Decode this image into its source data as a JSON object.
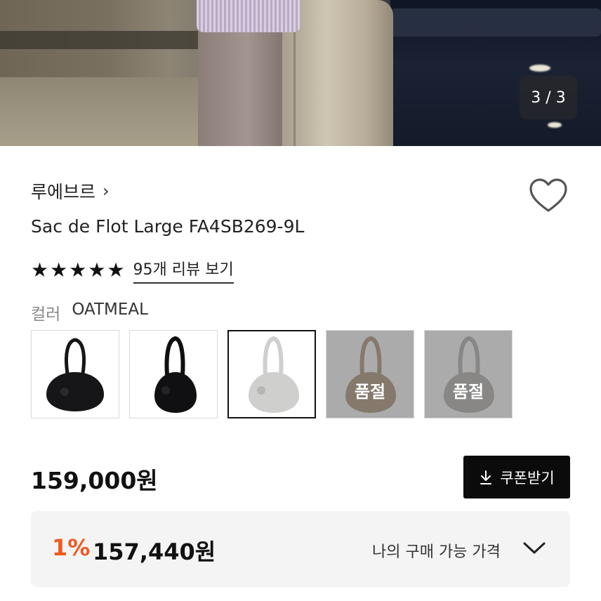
{
  "gallery": {
    "counter": "3 / 3"
  },
  "product": {
    "brand": "루에브르",
    "brand_chevron": "›",
    "title": "Sac de Flot Large FA4SB269-9L",
    "rating_stars": 5,
    "review_link": "95개 리뷰 보기"
  },
  "color": {
    "label": "컬러",
    "selected": "OATMEAL",
    "options": [
      {
        "bag_color": "#161618",
        "sold_out": false,
        "selected": false
      },
      {
        "bag_color": "#101012",
        "sold_out": false,
        "selected": false
      },
      {
        "bag_color": "#cfcfcd",
        "sold_out": false,
        "selected": true
      },
      {
        "bag_color": "#9b7b5b",
        "sold_out": true,
        "sold_label": "품절",
        "selected": false
      },
      {
        "bag_color": "#a4a09d",
        "sold_out": true,
        "sold_label": "품절",
        "selected": false
      }
    ]
  },
  "price": {
    "regular": "159,000원",
    "coupon_button": "쿠폰받기",
    "discount_rate": "1%",
    "final_price": "157,440원",
    "my_price_label": "나의 구매 가능 가격"
  },
  "colors": {
    "accent": "#ef5a23",
    "button_bg": "#0b0b0b",
    "panel_bg": "#f4f4f4"
  }
}
